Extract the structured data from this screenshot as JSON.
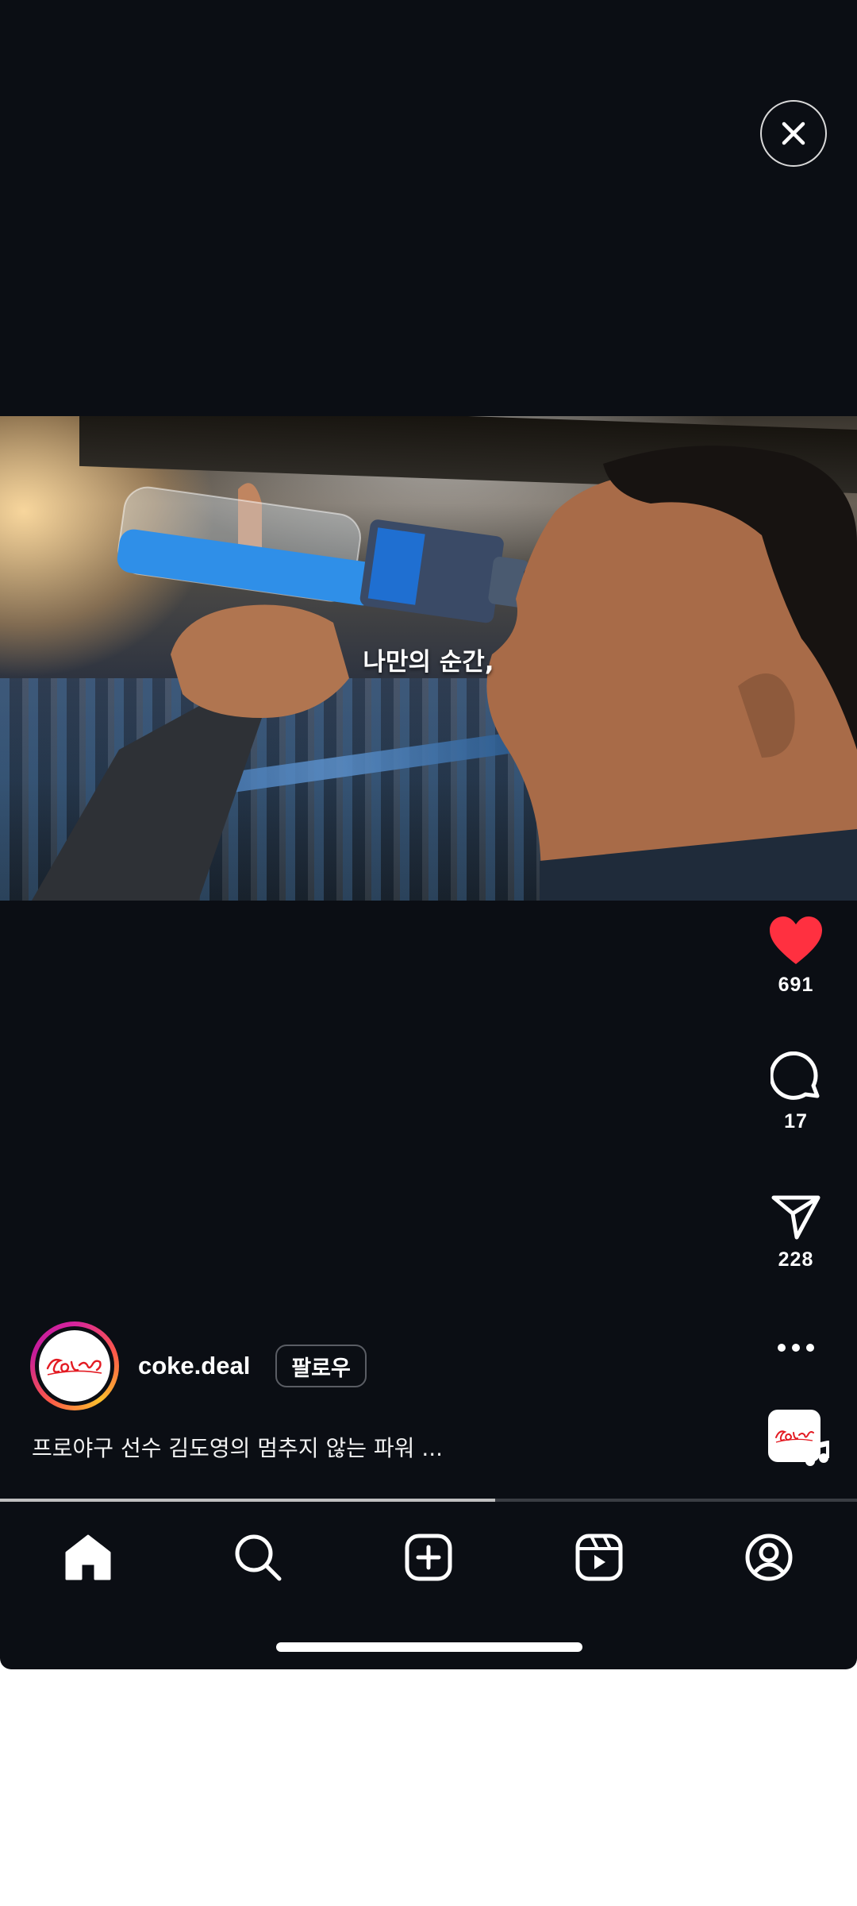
{
  "video": {
    "subtitle": "나만의 순간,"
  },
  "actions": {
    "likes": "691",
    "comments": "17",
    "shares": "228"
  },
  "post": {
    "username": "coke.deal",
    "follow_label": "팔로우",
    "caption": "프로야구 선수 김도영의 멈추지 않는 파워 ...",
    "avatar_brand": "Coca-Cola",
    "progress": 0.578
  },
  "colors": {
    "background": "#0b0e14",
    "like": "#ff3040",
    "brand_red": "#e31b23"
  },
  "icons": {
    "close": "close-icon",
    "like": "heart-icon",
    "comment": "comment-icon",
    "share": "send-icon",
    "more": "more-icon",
    "music": "music-note-icon",
    "nav": [
      "home-icon",
      "search-icon",
      "create-icon",
      "reels-icon",
      "profile-icon"
    ]
  }
}
